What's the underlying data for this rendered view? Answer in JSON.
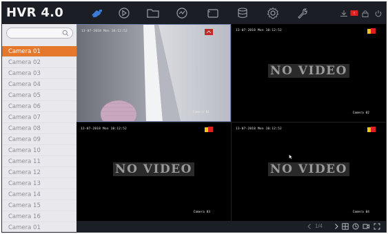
{
  "app": {
    "title": "HVR 4.0"
  },
  "nav": {
    "items": [
      {
        "icon": "live-view-camera-icon",
        "active": true
      },
      {
        "icon": "playback-icon"
      },
      {
        "icon": "file-management-icon"
      },
      {
        "icon": "smart-analysis-icon"
      },
      {
        "icon": "configuration-icon"
      },
      {
        "icon": "storage-icon"
      },
      {
        "icon": "system-settings-gear-icon"
      },
      {
        "icon": "maintenance-wrench-icon"
      }
    ],
    "right_icons": [
      "download-icon",
      "alarm-icon",
      "lock-icon",
      "power-icon"
    ]
  },
  "sidebar": {
    "search_placeholder": "",
    "cameras": [
      "Camera 01",
      "Camera 02",
      "Camera 03",
      "Camera 04",
      "Camera 05",
      "Camera 06",
      "Camera 07",
      "Camera 08",
      "Camera 09",
      "Camera 10",
      "Camera 11",
      "Camera 12",
      "Camera 13",
      "Camera 14",
      "Camera 15",
      "Camera 16",
      "Camera 01"
    ],
    "active_index": 0
  },
  "tiles": [
    {
      "timestamp": "13-07-2018 Mon 10:12:52",
      "camera": "Camera 01",
      "no_video": ""
    },
    {
      "timestamp": "13-07-2018 Mon 10:12:52",
      "camera": "Camera 02",
      "no_video": "NO VIDEO"
    },
    {
      "timestamp": "13-07-2018 Mon 10:12:52",
      "camera": "Camera 03",
      "no_video": "NO VIDEO"
    },
    {
      "timestamp": "13-07-2018 Mon 10:12:52",
      "camera": "Camera 04",
      "no_video": "NO VIDEO"
    }
  ],
  "bottombar": {
    "page": "1/4"
  },
  "colors": {
    "accent": "#e5782c",
    "topbar": "#1b1e24",
    "sidebar": "#e9e9ed",
    "nav_active": "#3a7bd5",
    "alarm_red": "#e02020",
    "alarm_yellow": "#f0c419"
  }
}
